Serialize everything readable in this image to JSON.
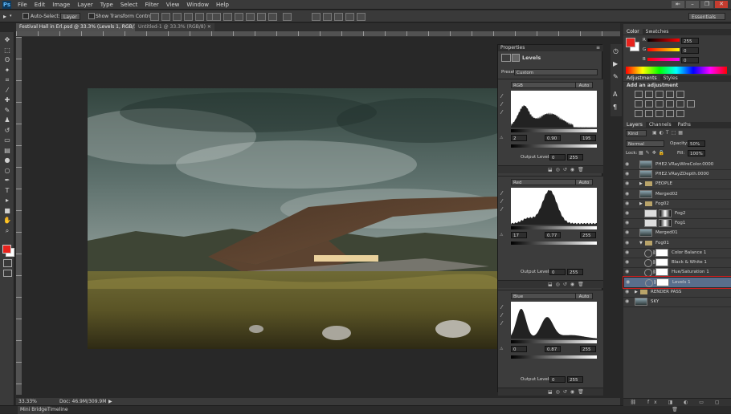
{
  "app": {
    "logo": "Ps"
  },
  "menu": [
    "File",
    "Edit",
    "Image",
    "Layer",
    "Type",
    "Select",
    "Filter",
    "View",
    "Window",
    "Help"
  ],
  "window_buttons": [
    "⇤",
    "–",
    "❐",
    "✕"
  ],
  "options": {
    "auto_select_label": "Auto-Select:",
    "auto_select_value": "Layer",
    "transform_label": "Show Transform Controls",
    "workspace": "Essentials"
  },
  "tabs": [
    {
      "label": "Festival Hall in Erl.psd @ 33.3% (Levels 1, RGB/16#) *",
      "active": true
    },
    {
      "label": "Untitled-1 @ 33.3% (RGB/8)",
      "active": false
    }
  ],
  "status": {
    "zoom": "33.33%",
    "doc": "Doc: 46.9M/309.9M"
  },
  "bottom_tabs": [
    "Mini Bridge",
    "Timeline"
  ],
  "properties": {
    "tab": "Properties",
    "title": "Levels",
    "preset_label": "Preset:",
    "preset_value": "Custom",
    "output_label": "Output Levels:",
    "auto_label": "Auto",
    "levels": [
      {
        "channel": "RGB",
        "in_black": "2",
        "gamma": "0.90",
        "in_white": "195",
        "out_black": "0",
        "out_white": "255"
      },
      {
        "channel": "Red",
        "in_black": "17",
        "gamma": "0.77",
        "in_white": "255",
        "out_black": "0",
        "out_white": "255"
      },
      {
        "channel": "Blue",
        "in_black": "0",
        "gamma": "0.87",
        "in_white": "255",
        "out_black": "0",
        "out_white": "255"
      }
    ]
  },
  "color_panel": {
    "tabs": [
      "Color",
      "Swatches"
    ],
    "r": "255",
    "g": "0",
    "b": "0",
    "r_label": "R",
    "g_label": "G",
    "b_label": "B"
  },
  "adjustments": {
    "tabs": [
      "Adjustments",
      "Styles"
    ],
    "title": "Add an adjustment"
  },
  "layers_panel": {
    "tabs": [
      "Layers",
      "Channels",
      "Paths"
    ],
    "kind": "Kind",
    "blend": "Normal",
    "opacity_label": "Opacity:",
    "opacity": "50%",
    "lock_label": "Lock:",
    "fill_label": "Fill:",
    "fill": "100%",
    "layers": [
      {
        "name": "PHE2.VRayWireColor.0000",
        "indent": 1,
        "kind": "image"
      },
      {
        "name": "PHE2.VRayZDepth.0000",
        "indent": 1,
        "kind": "image"
      },
      {
        "name": "PEOPLE",
        "indent": 1,
        "kind": "folder"
      },
      {
        "name": "Merged02",
        "indent": 1,
        "kind": "image"
      },
      {
        "name": "Fog02",
        "indent": 1,
        "kind": "folder"
      },
      {
        "name": "Fog2",
        "indent": 2,
        "kind": "mask"
      },
      {
        "name": "Fog1",
        "indent": 2,
        "kind": "mask"
      },
      {
        "name": "Merged01",
        "indent": 1,
        "kind": "image"
      },
      {
        "name": "Fog01",
        "indent": 1,
        "kind": "folder-open"
      },
      {
        "name": "Color Balance 1",
        "indent": 2,
        "kind": "adjust"
      },
      {
        "name": "Black & White 1",
        "indent": 2,
        "kind": "adjust"
      },
      {
        "name": "Hue/Saturation 1",
        "indent": 2,
        "kind": "adjust"
      },
      {
        "name": "Levels 1",
        "indent": 2,
        "kind": "adjust",
        "selected": true
      },
      {
        "name": "RENDER PASS",
        "indent": 0,
        "kind": "folder"
      },
      {
        "name": "SKY",
        "indent": 0,
        "kind": "image"
      }
    ]
  },
  "colors": {
    "foreground": "#e8231d",
    "background": "#ffffff",
    "selection": "#596e8c",
    "highlight": "#d21f1f"
  }
}
